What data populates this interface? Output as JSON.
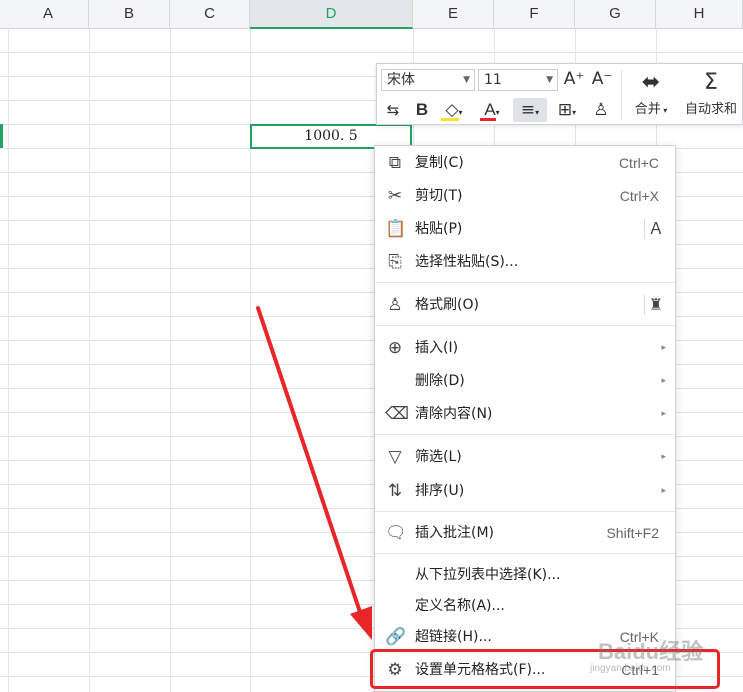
{
  "spreadsheet": {
    "columns": [
      "A",
      "B",
      "C",
      "D",
      "E",
      "F",
      "G",
      "H"
    ],
    "active_column": "D",
    "active_cell_value": "1000. 5"
  },
  "mini_toolbar": {
    "font_name": "宋体",
    "font_size": "11",
    "increase_font": "A⁺",
    "decrease_font": "A⁻",
    "merge_label": "合并",
    "autosum_label": "自动求和",
    "bold_glyph": "B",
    "font_color_glyph": "A",
    "fill_color": "#f5e52a",
    "font_color": "#e5262a"
  },
  "context_menu": {
    "items": [
      {
        "label": "复制(C)",
        "shortcut": "Ctrl+C",
        "icon": "copy-icon"
      },
      {
        "label": "剪切(T)",
        "shortcut": "Ctrl+X",
        "icon": "cut-icon"
      },
      {
        "label": "粘贴(P)",
        "icon": "paste-icon"
      },
      {
        "label": "选择性粘贴(S)...",
        "icon": "paste-special-icon"
      },
      {
        "label": "格式刷(O)",
        "icon": "format-painter-icon"
      },
      {
        "label": "插入(I)",
        "icon": "insert-icon"
      },
      {
        "label": "删除(D)"
      },
      {
        "label": "清除内容(N)",
        "icon": "clear-icon"
      },
      {
        "label": "筛选(L)",
        "icon": "filter-icon"
      },
      {
        "label": "排序(U)",
        "icon": "sort-icon"
      },
      {
        "label": "插入批注(M)",
        "shortcut": "Shift+F2",
        "icon": "comment-icon"
      },
      {
        "label": "从下拉列表中选择(K)..."
      },
      {
        "label": "定义名称(A)..."
      },
      {
        "label": "超链接(H)...",
        "shortcut": "Ctrl+K",
        "icon": "link-icon"
      },
      {
        "label": "设置单元格格式(F)...",
        "shortcut": "Ctrl+1",
        "icon": "format-cells-icon"
      }
    ]
  },
  "annotation": {
    "arrow_color": "#e8262a",
    "watermark": "Baidu经验",
    "watermark_sub": "jingyan.baidu.com"
  }
}
